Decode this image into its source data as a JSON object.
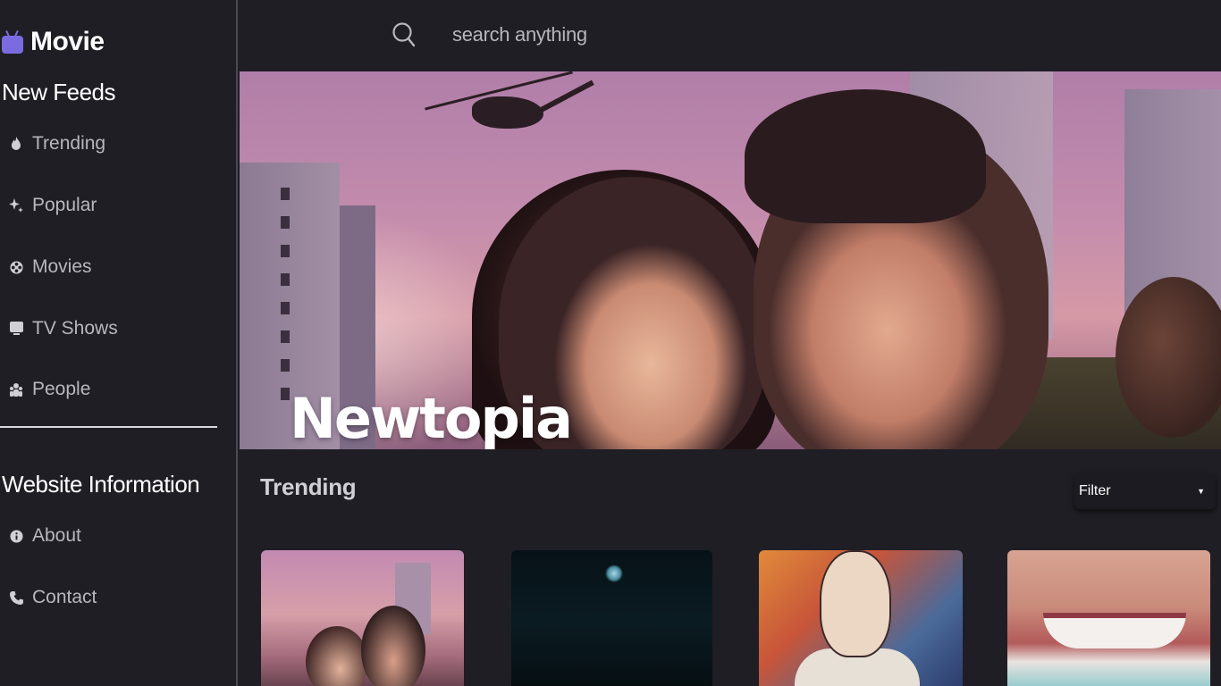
{
  "app": {
    "logo_text": "Movie",
    "logo_icon": "tv-icon",
    "accent_color": "#7b6be0"
  },
  "sidebar": {
    "feeds_title": "New Feeds",
    "feeds": [
      {
        "label": "Trending",
        "icon": "fire-icon"
      },
      {
        "label": "Popular",
        "icon": "sparkle-icon"
      },
      {
        "label": "Movies",
        "icon": "film-reel-icon"
      },
      {
        "label": "TV Shows",
        "icon": "tv-icon"
      },
      {
        "label": "People",
        "icon": "people-icon"
      }
    ],
    "info_title": "Website Information",
    "info": [
      {
        "label": "About",
        "icon": "info-icon"
      },
      {
        "label": "Contact",
        "icon": "phone-icon"
      }
    ]
  },
  "search": {
    "placeholder": "search anything",
    "icon": "search-icon"
  },
  "hero": {
    "title": "Newtopia"
  },
  "trending": {
    "title": "Trending",
    "filter_label": "Filter"
  }
}
